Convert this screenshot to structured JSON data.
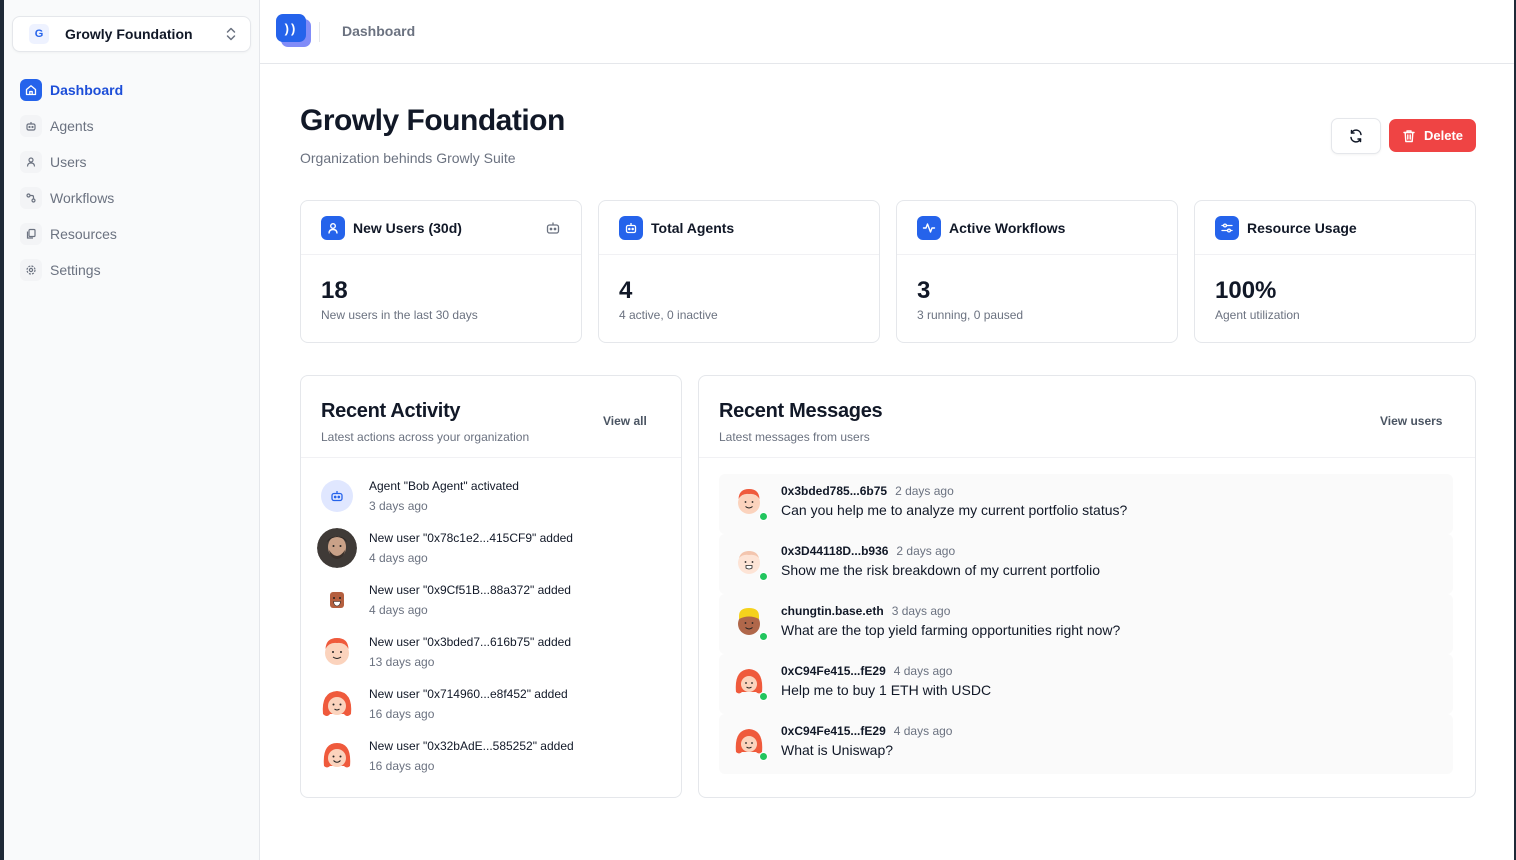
{
  "sidebar": {
    "org": {
      "initial": "G",
      "name": "Growly Foundation"
    },
    "items": [
      {
        "label": "Dashboard",
        "icon": "home-icon",
        "active": true
      },
      {
        "label": "Agents",
        "icon": "bot-icon"
      },
      {
        "label": "Users",
        "icon": "user-icon"
      },
      {
        "label": "Workflows",
        "icon": "workflow-icon"
      },
      {
        "label": "Resources",
        "icon": "files-icon"
      },
      {
        "label": "Settings",
        "icon": "gear-icon"
      }
    ]
  },
  "topbar": {
    "logo_text": "))",
    "title": "Dashboard"
  },
  "header": {
    "title": "Growly Foundation",
    "subtitle": "Organization behinds Growly Suite",
    "delete_label": "Delete"
  },
  "stats": [
    {
      "title": "New Users (30d)",
      "value": "18",
      "desc": "New users in the last 30 days",
      "icon": "user-icon"
    },
    {
      "title": "Total Agents",
      "value": "4",
      "desc": "4 active, 0 inactive",
      "icon": "bot-icon"
    },
    {
      "title": "Active Workflows",
      "value": "3",
      "desc": "3 running, 0 paused",
      "icon": "activity-icon"
    },
    {
      "title": "Resource Usage",
      "value": "100%",
      "desc": "Agent utilization",
      "icon": "sliders-icon"
    }
  ],
  "activity": {
    "title": "Recent Activity",
    "subtitle": "Latest actions across your organization",
    "link": "View all",
    "items": [
      {
        "text": "Agent \"Bob Agent\" activated",
        "time": "3 days ago"
      },
      {
        "text": "New user \"0x78c1e2...415CF9\" added",
        "time": "4 days ago"
      },
      {
        "text": "New user \"0x9Cf51B...88a372\" added",
        "time": "4 days ago"
      },
      {
        "text": "New user \"0x3bded7...616b75\" added",
        "time": "13 days ago"
      },
      {
        "text": "New user \"0x714960...e8f452\" added",
        "time": "16 days ago"
      },
      {
        "text": "New user \"0x32bAdE...585252\" added",
        "time": "16 days ago"
      }
    ]
  },
  "messages": {
    "title": "Recent Messages",
    "subtitle": "Latest messages from users",
    "link": "View users",
    "items": [
      {
        "sender": "0x3bded785...6b75",
        "time": "2 days ago",
        "text": "Can you help me to analyze my current portfolio status?"
      },
      {
        "sender": "0x3D44118D...b936",
        "time": "2 days ago",
        "text": "Show me the risk breakdown of my current portfolio"
      },
      {
        "sender": "chungtin.base.eth",
        "time": "3 days ago",
        "text": "What are the top yield farming opportunities right now?"
      },
      {
        "sender": "0xC94Fe415...fE29",
        "time": "4 days ago",
        "text": "Help me to buy 1 ETH with USDC"
      },
      {
        "sender": "0xC94Fe415...fE29",
        "time": "4 days ago",
        "text": "What is Uniswap?"
      }
    ]
  },
  "colors": {
    "primary": "#2563eb",
    "danger": "#ef4444",
    "online": "#22c55e"
  }
}
